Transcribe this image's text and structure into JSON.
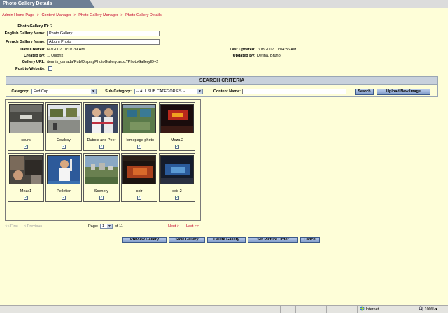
{
  "page": {
    "title": "Photo Gallery Details",
    "breadcrumb": [
      "Admin Home Page",
      "Content Manager",
      "Photo Gallery Manager",
      "Photo Gallery Details"
    ],
    "breadcrumb_sep": ">"
  },
  "details": {
    "gallery_id_label": "Photo Gallery ID:",
    "gallery_id": "2",
    "english_name_label": "English Gallery Name:",
    "english_name": "Photo Gallery",
    "french_name_label": "French Gallery Name:",
    "french_name": "Album Photo",
    "date_created_label": "Date Created:",
    "date_created": "6/7/2007 10:07:39 AM",
    "created_by_label": "Created By:",
    "created_by": "1, Uniprix",
    "gallery_url_label": "Gallery URL:",
    "gallery_url": "/tennis_canada/Pub/DisplayPhotoGallery.aspx?PhotoGalleryID=2",
    "post_label": "Post to Website:",
    "last_updated_label": "Last Updated:",
    "last_updated": "7/18/2007 11:04:36 AM",
    "updated_by_label": "Updated By:",
    "updated_by": "Defina, Bruno"
  },
  "search": {
    "header": "SEARCH CRITERIA",
    "category_label": "Category:",
    "category_value": "Fed Cup",
    "subcategory_label": "Sub-Category:",
    "subcategory_value": "-- ALL SUB CATEGORIES --",
    "content_name_label": "Content Name:",
    "content_name_value": "",
    "search_button": "Search",
    "upload_button": "Upload New Image"
  },
  "gallery": {
    "items": [
      {
        "name": "cours",
        "checked": true,
        "thumb": "stadium-crowd"
      },
      {
        "name": "Cowboy",
        "checked": true,
        "thumb": "outdoor-event"
      },
      {
        "name": "Dubois and Peer",
        "checked": true,
        "thumb": "two-players"
      },
      {
        "name": "Homepage photo",
        "checked": true,
        "thumb": "aerial-courts"
      },
      {
        "name": "Meza 2",
        "checked": true,
        "thumb": "night-concert"
      },
      {
        "name": "Meza1",
        "checked": true,
        "thumb": "crowd-closeup"
      },
      {
        "name": "Pelletier",
        "checked": true,
        "thumb": "player-serve"
      },
      {
        "name": "Scenery",
        "checked": true,
        "thumb": "city-landscape"
      },
      {
        "name": "soir",
        "checked": true,
        "thumb": "night-arena"
      },
      {
        "name": "soir 2",
        "checked": true,
        "thumb": "arena-blue"
      }
    ]
  },
  "pager": {
    "first": "<< First",
    "previous": "< Previous",
    "page_label": "Page:",
    "current_page": "1",
    "of_label": "of 11",
    "next": "Next >",
    "last": "Last >>"
  },
  "actions": {
    "preview": "Preview Gallery",
    "save": "Save Gallery",
    "delete": "Delete Gallery",
    "order": "Set Picture Order",
    "cancel": "Cancel"
  },
  "statusbar": {
    "zone": "Internet",
    "zoom": "100%"
  },
  "colors": {
    "background": "#fefed8",
    "link_red": "#c4002b",
    "title_blue": "#6e7f94",
    "button_blue": "#7e99c8"
  }
}
